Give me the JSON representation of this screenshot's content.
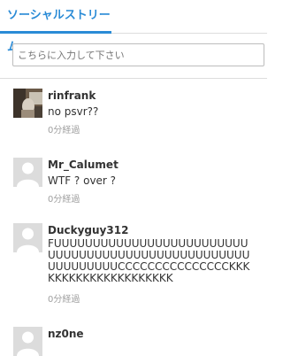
{
  "tab": {
    "label": "ソーシャルストリーム"
  },
  "comment_input": {
    "placeholder": "こちらに入力して下さい"
  },
  "posts": [
    {
      "user": "rinfrank",
      "message": "no psvr??",
      "time": "0分経過",
      "avatar": "photo-avatar"
    },
    {
      "user": "Mr_Calumet",
      "message": "WTF ? over ?",
      "time": "0分経過",
      "avatar": "default-avatar"
    },
    {
      "user": "Duckyguy312",
      "message": "FUUUUUUUUUUUUUUUUUUUUUUUUUUUUUUUUUUUUUUUUUUUUUUUUUUUUUUUUUUUUCCCCCCCCCCCCCCCKKKKKKKKKKKKKKKKKKKKK",
      "time": "0分経過",
      "avatar": "default-avatar"
    },
    {
      "user": "nz0ne",
      "message": "",
      "time": "",
      "avatar": "default-avatar"
    }
  ]
}
